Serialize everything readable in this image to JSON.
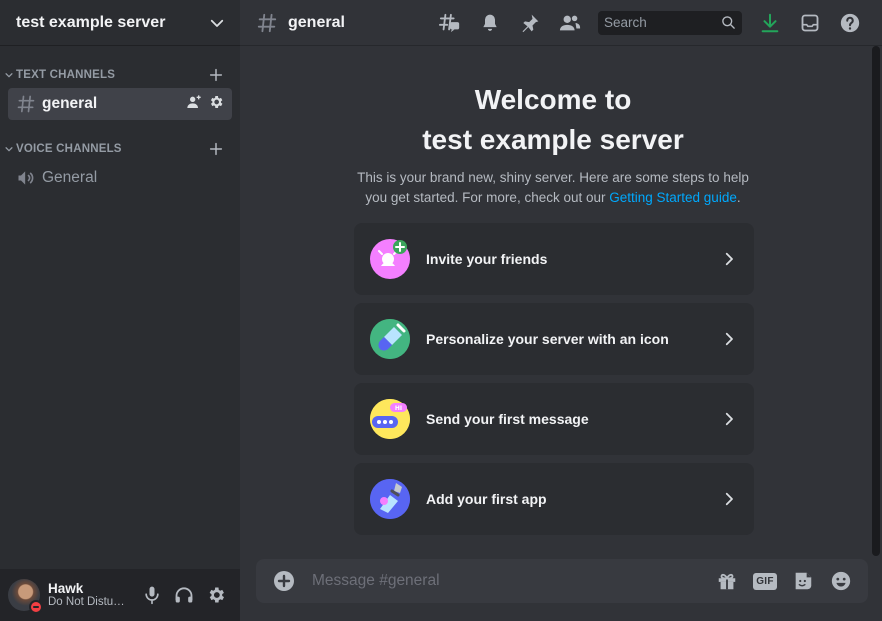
{
  "server": {
    "name": "test example server"
  },
  "sidebar": {
    "text_category": "TEXT CHANNELS",
    "voice_category": "VOICE CHANNELS",
    "text_channels": [
      {
        "name": "general",
        "active": true
      }
    ],
    "voice_channels": [
      {
        "name": "General"
      }
    ]
  },
  "user": {
    "name": "Hawk",
    "status": "Do Not Distu…"
  },
  "topbar": {
    "channel": "general",
    "search_placeholder": "Search"
  },
  "welcome": {
    "title_line1": "Welcome to",
    "title_line2": "test example server",
    "subtitle": "This is your brand new, shiny server. Here are some steps to help you get started. For more, check out our ",
    "link": "Getting Started guide",
    "subtitle_end": "."
  },
  "steps": [
    {
      "label": "Invite your friends",
      "icon": "invite-friends-icon",
      "color": "#f47fff"
    },
    {
      "label": "Personalize your server with an icon",
      "icon": "paintbrush-icon",
      "color": "#3ba55c"
    },
    {
      "label": "Send your first message",
      "icon": "chat-bubble-icon",
      "color": "#fee75c"
    },
    {
      "label": "Add your first app",
      "icon": "app-robot-icon",
      "color": "#5865f2"
    }
  ],
  "composer": {
    "placeholder": "Message #general",
    "gif_label": "GIF"
  },
  "colors": {
    "accent_link": "#00a8fc",
    "download_green": "#23a55a",
    "dnd_red": "#f23f43"
  }
}
